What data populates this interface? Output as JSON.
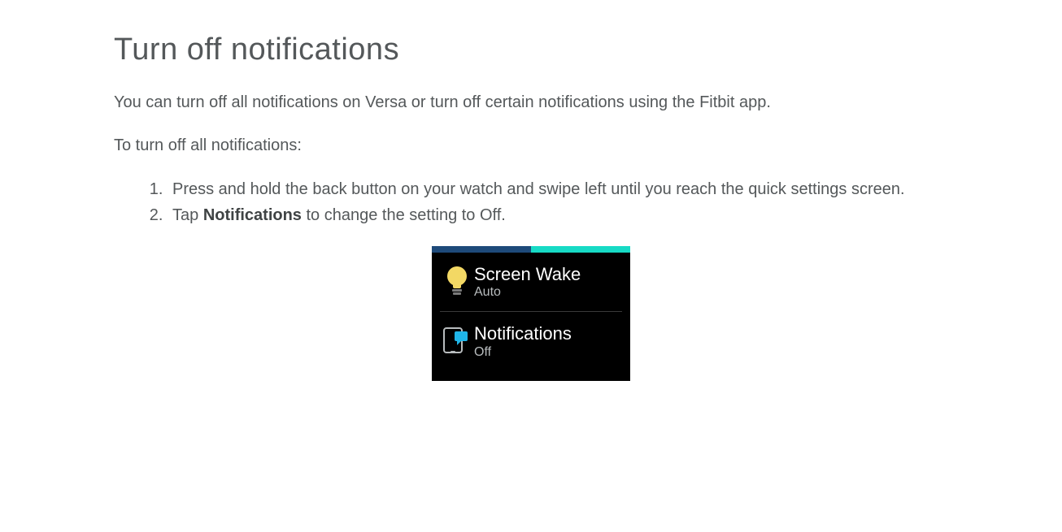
{
  "heading": "Turn off notifications",
  "intro": "You can turn off all notifications on Versa or turn off certain notifications using the Fitbit app.",
  "instruction_lead": "To turn off all notifications:",
  "steps": {
    "s1": "Press and hold the back button on your watch and swipe left until you reach the quick settings screen.",
    "s2_pre": "Tap ",
    "s2_bold": "Notifications",
    "s2_post": " to change the setting to Off."
  },
  "watch": {
    "row1": {
      "title": "Screen Wake",
      "sub": "Auto"
    },
    "row2": {
      "title": "Notifications",
      "sub": "Off"
    }
  }
}
